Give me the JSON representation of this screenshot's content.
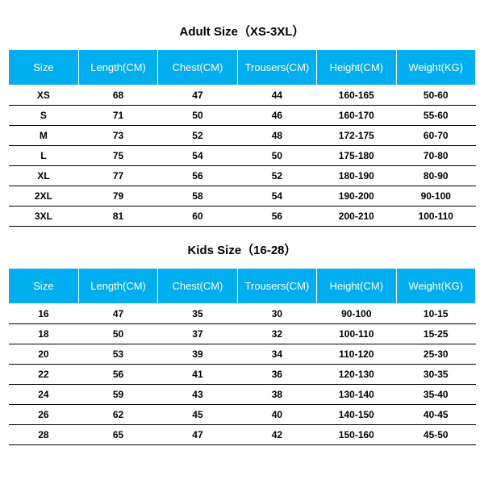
{
  "adult": {
    "title": "Adult Size（XS-3XL）",
    "headers": [
      "Size",
      "Length(CM)",
      "Chest(CM)",
      "Trousers(CM)",
      "Height(CM)",
      "Weight(KG)"
    ],
    "rows": [
      [
        "XS",
        "68",
        "47",
        "44",
        "160-165",
        "50-60"
      ],
      [
        "S",
        "71",
        "50",
        "46",
        "160-170",
        "55-60"
      ],
      [
        "M",
        "73",
        "52",
        "48",
        "172-175",
        "60-70"
      ],
      [
        "L",
        "75",
        "54",
        "50",
        "175-180",
        "70-80"
      ],
      [
        "XL",
        "77",
        "56",
        "52",
        "180-190",
        "80-90"
      ],
      [
        "2XL",
        "79",
        "58",
        "54",
        "190-200",
        "90-100"
      ],
      [
        "3XL",
        "81",
        "60",
        "56",
        "200-210",
        "100-110"
      ]
    ]
  },
  "kids": {
    "title": "Kids Size（16-28）",
    "headers": [
      "Size",
      "Length(CM)",
      "Chest(CM)",
      "Trousers(CM)",
      "Height(CM)",
      "Weight(KG)"
    ],
    "rows": [
      [
        "16",
        "47",
        "35",
        "30",
        "90-100",
        "10-15"
      ],
      [
        "18",
        "50",
        "37",
        "32",
        "100-110",
        "15-25"
      ],
      [
        "20",
        "53",
        "39",
        "34",
        "110-120",
        "25-30"
      ],
      [
        "22",
        "56",
        "41",
        "36",
        "120-130",
        "30-35"
      ],
      [
        "24",
        "59",
        "43",
        "38",
        "130-140",
        "35-40"
      ],
      [
        "26",
        "62",
        "45",
        "40",
        "140-150",
        "40-45"
      ],
      [
        "28",
        "65",
        "47",
        "42",
        "150-160",
        "45-50"
      ]
    ]
  }
}
